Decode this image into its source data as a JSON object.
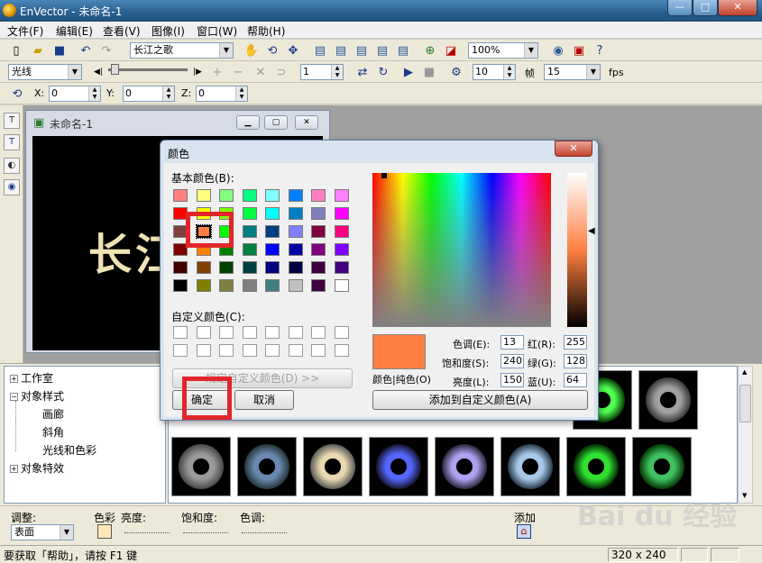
{
  "window": {
    "title": "EnVector - 未命名-1",
    "min": "—",
    "max": "□",
    "close": "✕"
  },
  "menu": [
    "文件(F)",
    "编辑(E)",
    "查看(V)",
    "图像(I)",
    "窗口(W)",
    "帮助(H)"
  ],
  "toolbar1": {
    "font": "长江之歌",
    "zoom": "100%"
  },
  "toolbar2": {
    "effect": "光线",
    "frame": "1",
    "speed": "10",
    "fps_value": "15",
    "frame_label": "帧",
    "fps_label": "fps"
  },
  "toolbar3": {
    "x_label": "X:",
    "y_label": "Y:",
    "z_label": "Z:",
    "x": "0",
    "y": "0",
    "z": "0"
  },
  "doc": {
    "title": "未命名-1",
    "canvas_text": "长江"
  },
  "tree": {
    "items": [
      "工作室",
      "对象样式",
      "画廊",
      "斜角",
      "光线和色彩",
      "对象特效"
    ]
  },
  "adjust": {
    "label": "调整:",
    "mode": "表面",
    "color": "色彩",
    "brightness": "亮度:",
    "saturation": "饱和度:",
    "hue": "色调:",
    "add": "添加"
  },
  "status": {
    "help": "要获取「帮助」，请按 F1 键",
    "size": "320 x 240"
  },
  "dialog": {
    "title": "颜色",
    "basic_label": "基本颜色(B):",
    "custom_label": "自定义颜色(C):",
    "define_btn": "规定自定义颜色(D) >>",
    "ok": "确定",
    "cancel": "取消",
    "add_custom": "添加到自定义颜色(A)",
    "solid": "颜色|纯色(O)",
    "hue_label": "色调(E):",
    "sat_label": "饱和度(S):",
    "lum_label": "亮度(L):",
    "red_label": "红(R):",
    "green_label": "绿(G):",
    "blue_label": "蓝(U):",
    "hue": "13",
    "sat": "240",
    "lum": "150",
    "red": "255",
    "green": "128",
    "blue": "64",
    "close": "✕"
  },
  "basic_colors": [
    "#ff8080",
    "#ffff80",
    "#80ff80",
    "#00ff80",
    "#80ffff",
    "#0080ff",
    "#ff80c0",
    "#ff80ff",
    "#ff0000",
    "#ffff00",
    "#80ff00",
    "#00ff40",
    "#00ffff",
    "#0080c0",
    "#8080c0",
    "#ff00ff",
    "#804040",
    "#ff8040",
    "#00ff00",
    "#008080",
    "#004080",
    "#8080ff",
    "#800040",
    "#ff0080",
    "#800000",
    "#ff8000",
    "#008000",
    "#008040",
    "#0000ff",
    "#0000a0",
    "#800080",
    "#8000ff",
    "#400000",
    "#804000",
    "#004000",
    "#004040",
    "#000080",
    "#000040",
    "#400040",
    "#400080",
    "#000000",
    "#808000",
    "#808040",
    "#808080",
    "#408080",
    "#c0c0c0",
    "#400040",
    "#ffffff"
  ],
  "gallery": [
    {
      "c1": "#9a9a9a",
      "c2": "#444"
    },
    {
      "c1": "#6a88b0",
      "c2": "#233"
    },
    {
      "c1": "#e8d8b0",
      "c2": "#555"
    },
    {
      "c1": "#5566ff",
      "c2": "#112"
    },
    {
      "c1": "#b0a0f0",
      "c2": "#223"
    },
    {
      "c1": "#a8c8e8",
      "c2": "#234"
    },
    {
      "c1": "#30e030",
      "c2": "#020"
    },
    {
      "c1": "#40c060",
      "c2": "#030"
    }
  ],
  "gallery_top": [
    {
      "c1": "#50ff50",
      "c2": "#030"
    },
    {
      "c1": "#a0a0a0",
      "c2": "#333"
    }
  ]
}
